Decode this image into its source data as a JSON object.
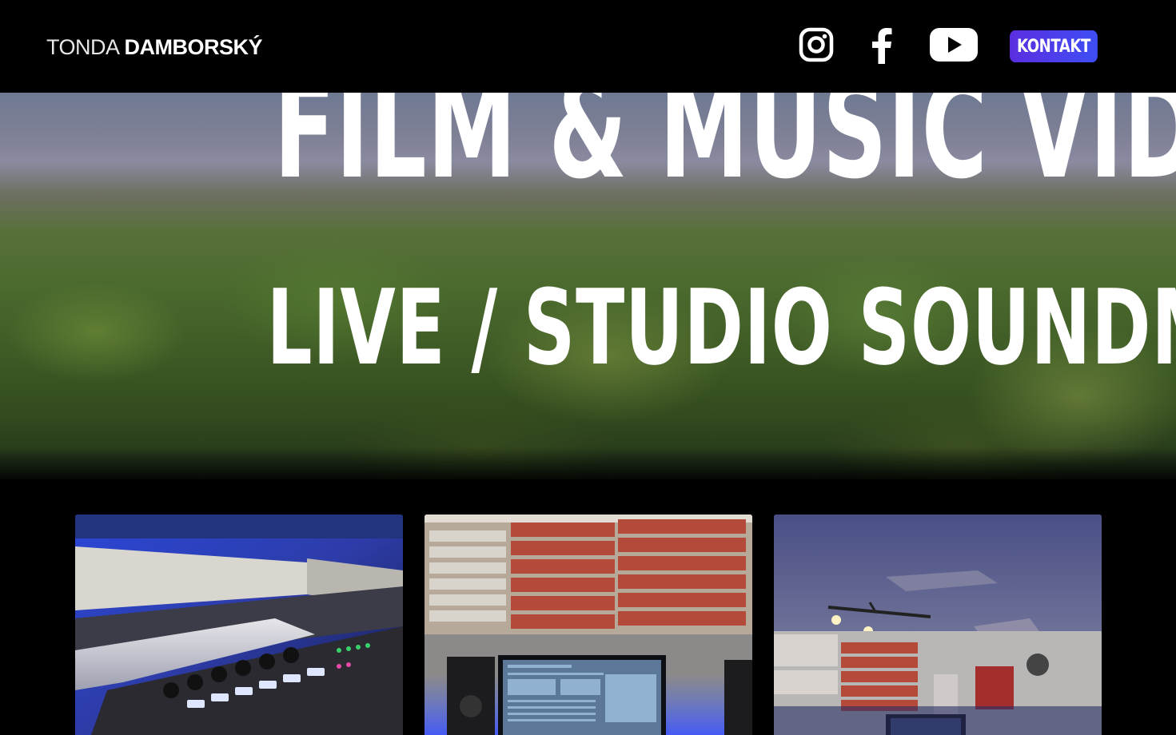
{
  "header": {
    "logo_first": "TONDA",
    "logo_last": "DAMBORSKÝ",
    "social": [
      {
        "name": "instagram",
        "icon": "instagram-icon"
      },
      {
        "name": "facebook",
        "icon": "facebook-icon"
      },
      {
        "name": "youtube",
        "icon": "youtube-icon"
      }
    ],
    "contact_label": "KONTAKT"
  },
  "hero": {
    "line1": "FILM & MUSIC VIDEO",
    "line2": "LIVE / STUDIO SOUNDMIXING"
  },
  "gallery": [
    {
      "subject": "mixing-console-photo"
    },
    {
      "subject": "studio-monitor-photo"
    },
    {
      "subject": "studio-room-photo"
    }
  ],
  "colors": {
    "header_bg": "#000000",
    "accent_gradient_start": "#5b2ee0",
    "accent_gradient_end": "#3e4ef5",
    "text": "#ffffff"
  }
}
